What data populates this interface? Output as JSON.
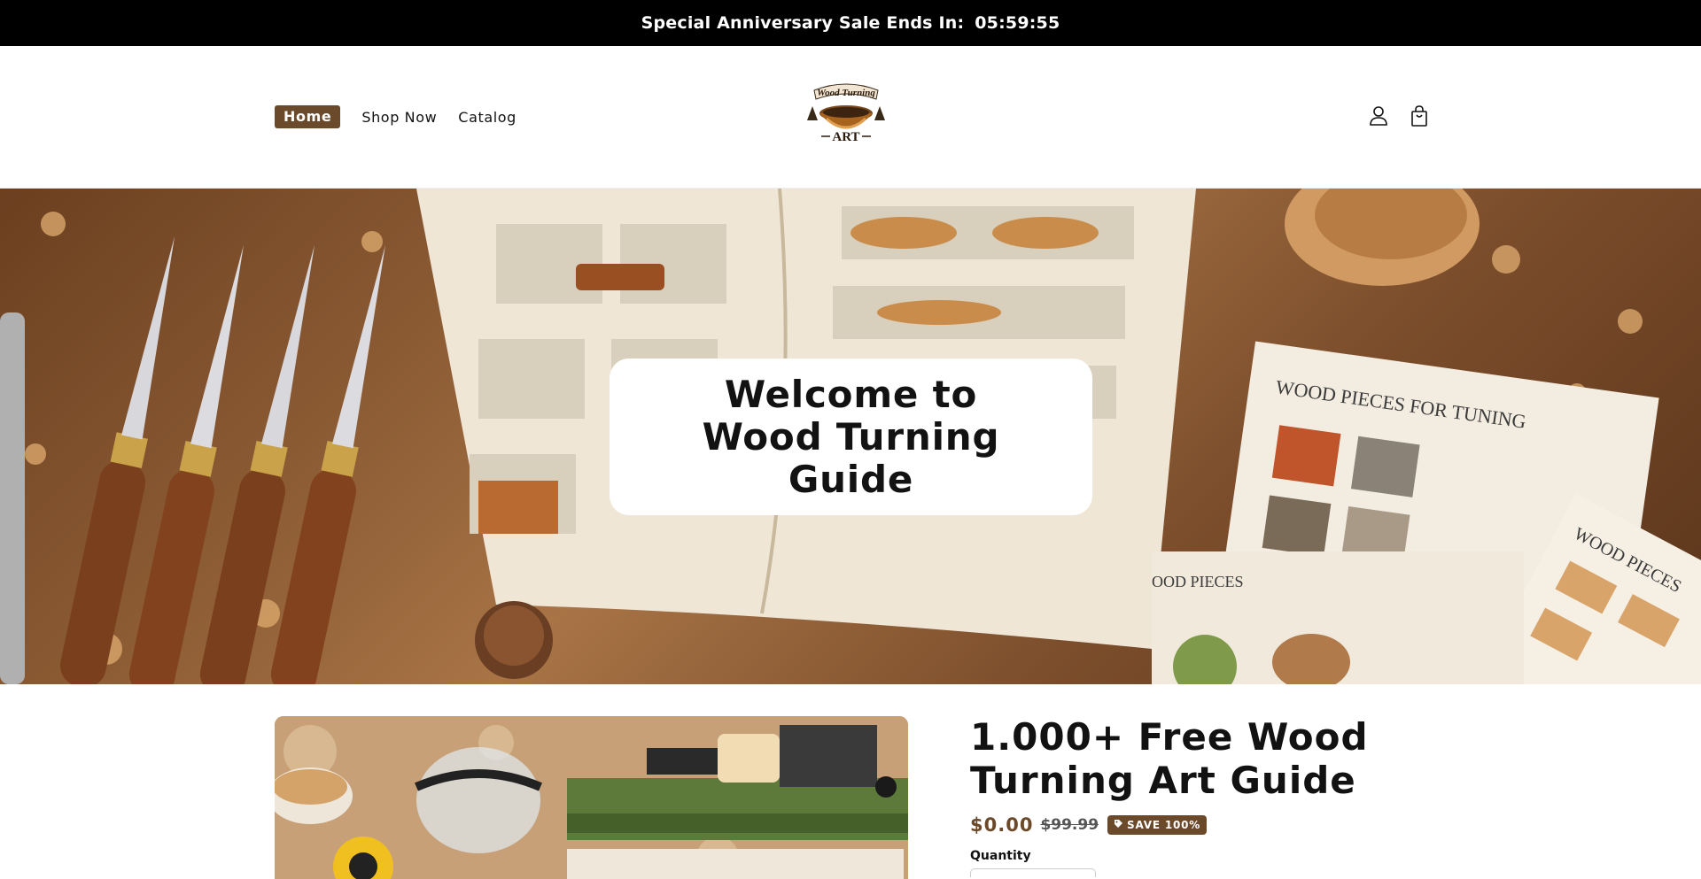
{
  "announcement": {
    "label": "Special Anniversary Sale Ends In:",
    "timer": "05:59:55"
  },
  "nav": {
    "items": [
      {
        "label": "Home",
        "active": true
      },
      {
        "label": "Shop Now",
        "active": false
      },
      {
        "label": "Catalog",
        "active": false
      }
    ]
  },
  "logo": {
    "top_text": "Wood Turning",
    "bottom_text": "ART"
  },
  "header_icons": [
    "account-icon",
    "cart-icon"
  ],
  "hero": {
    "title": "Welcome to Wood Turning Guide",
    "image_text": {
      "sheet_one": "WOOD PIECES FOR TUNING",
      "sheet_two": "WOOD PIECES",
      "sheet_three": "OOD PIECES"
    }
  },
  "product": {
    "title": "1.000+ Free Wood Turning Art Guide",
    "price": "$0.00",
    "compare_price": "$99.99",
    "badge": "SAVE 100%",
    "quantity_label": "Quantity"
  },
  "colors": {
    "accent": "#6b4a2b",
    "announcement_bg": "#000000"
  }
}
